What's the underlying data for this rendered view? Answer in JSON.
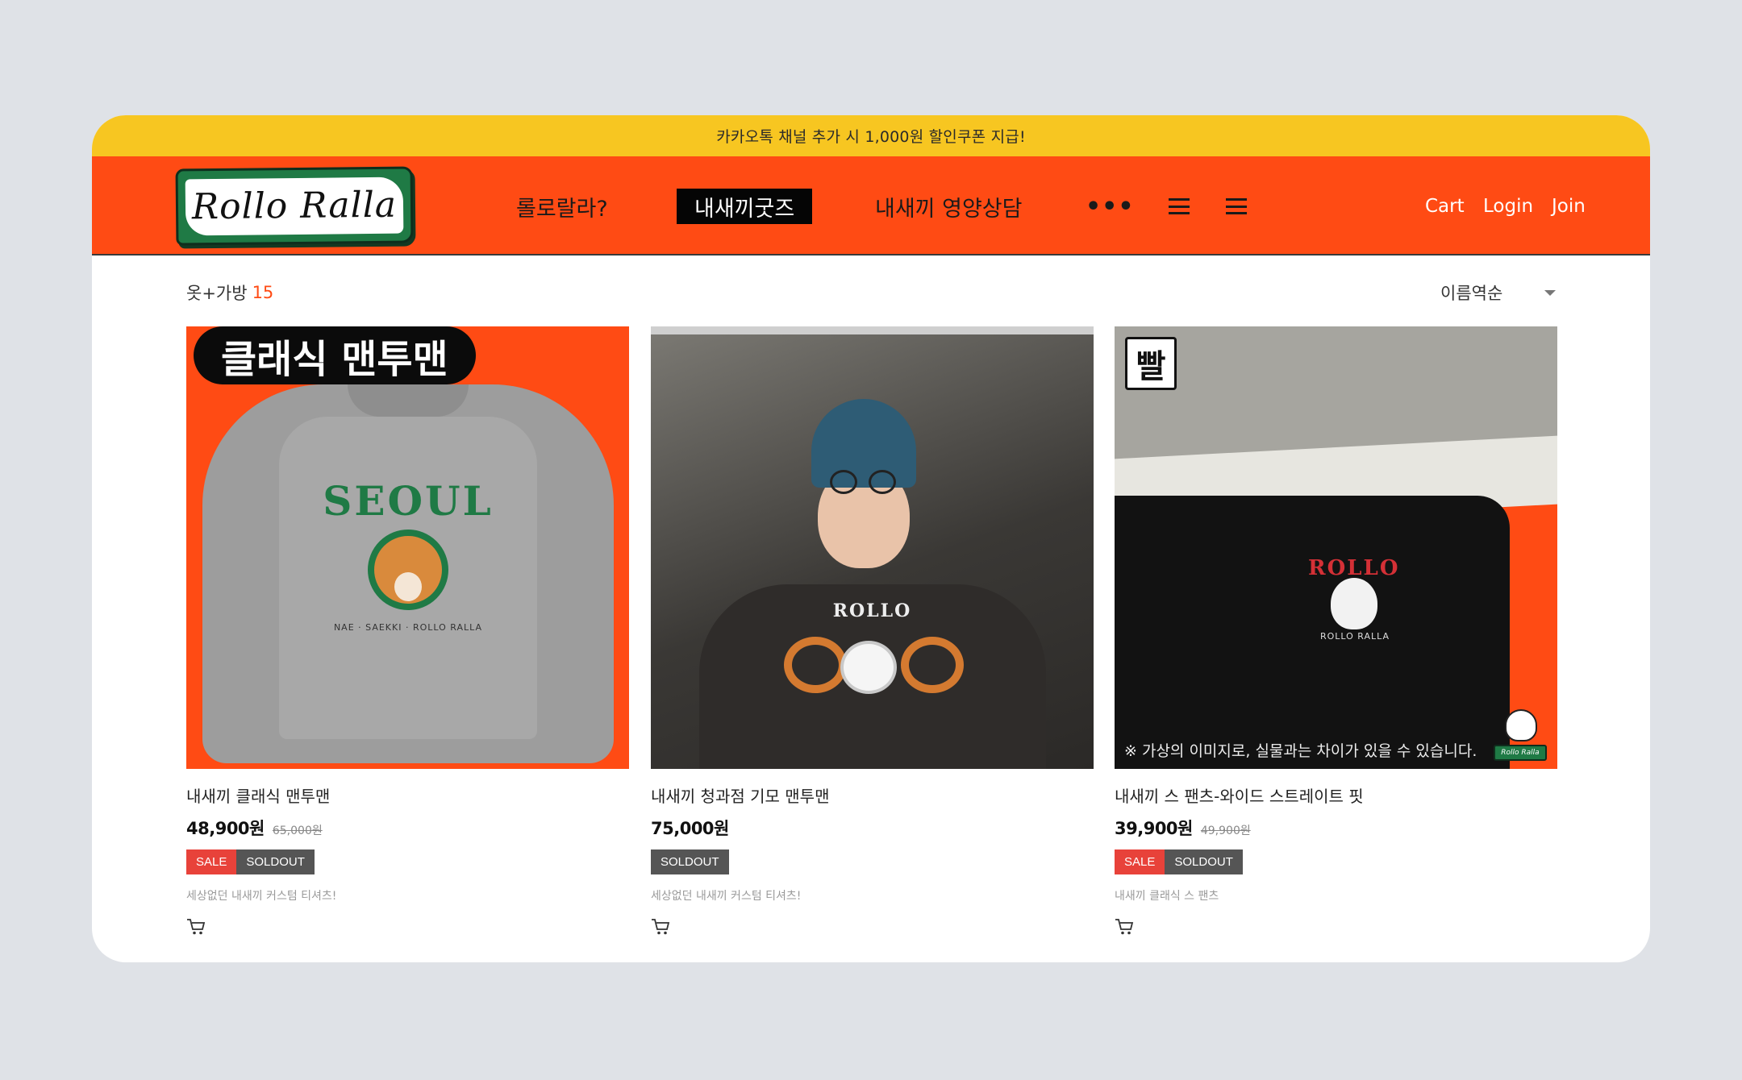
{
  "promo_banner": "카카오톡 채널 추가 시 1,000원 할인쿠폰 지급!",
  "header": {
    "logo_text": "Rollo Ralla",
    "nav": [
      {
        "label": "롤로랄라?"
      },
      {
        "label": "내새끼굿즈"
      },
      {
        "label": "내새끼 영양상담"
      }
    ],
    "more_label": "•••",
    "util": {
      "cart": "Cart",
      "login": "Login",
      "join": "Join"
    }
  },
  "category": {
    "title": "옷+가방",
    "count": "15"
  },
  "sort": {
    "selected": "이름역순"
  },
  "colors": {
    "brand_orange": "#ff4b14",
    "promo_yellow": "#f7c621",
    "sale_red": "#e8423a",
    "soldout_gray": "#555555",
    "logo_green": "#1f7a45"
  },
  "products": [
    {
      "image": {
        "badge": "클래식 맨투맨",
        "print": "SEOUL",
        "print_sub": "NAE · SAEKKI · ROLLO RALLA"
      },
      "name": "내새끼 클래식 맨투맨",
      "price": "48,900원",
      "original_price": "65,000원",
      "tags": {
        "sale": "SALE",
        "soldout": "SOLDOUT"
      },
      "description": "세상없던 내새끼 커스텀 티셔츠!"
    },
    {
      "image": {
        "print": "ROLLO"
      },
      "name": "내새끼 청과점 기모 맨투맨",
      "price": "75,000원",
      "tags": {
        "soldout": "SOLDOUT"
      },
      "description": "세상없던 내새끼 커스텀 티셔츠!"
    },
    {
      "image": {
        "badge": "빨",
        "print": "ROLLO",
        "print_sub": "ROLLO RALLA",
        "disclaimer": "※ 가상의 이미지로, 실물과는 차이가 있을 수 있습니다.",
        "mini_logo": "Rollo Ralla"
      },
      "name": "내새끼 스   팬츠-와이드 스트레이트 핏",
      "price": "39,900원",
      "original_price": "49,900원",
      "tags": {
        "sale": "SALE",
        "soldout": "SOLDOUT"
      },
      "description": "내새끼 클래식 스   팬츠"
    }
  ]
}
